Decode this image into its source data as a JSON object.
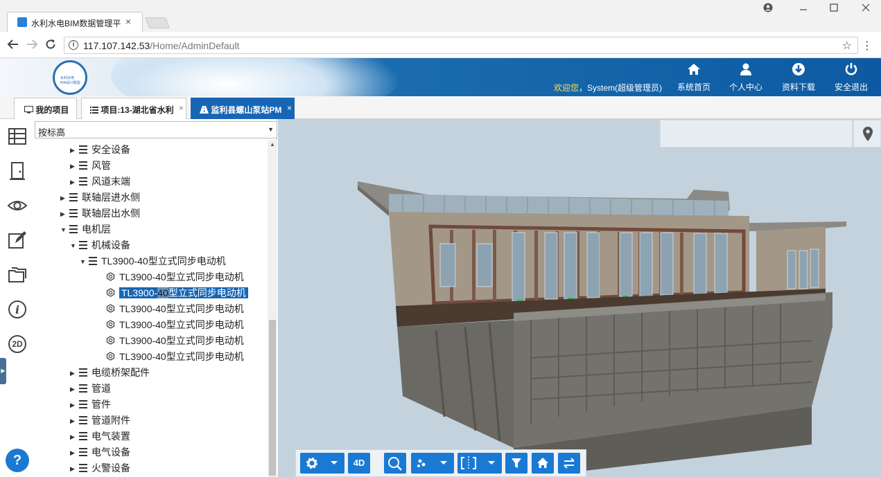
{
  "browser": {
    "tab_title": "水利水电BIM数据管理平",
    "tab_close": "×",
    "url_host": "117.107.142.53",
    "url_path": "/Home/AdminDefault"
  },
  "header": {
    "logo_line1": "水利水电",
    "logo_line2": "BIM设计联盟",
    "welcome_word": "欢迎您",
    "welcome_user": "，System(超级管理员)",
    "nav": [
      {
        "label": "系统首页",
        "icon": "home-icon"
      },
      {
        "label": "个人中心",
        "icon": "user-icon"
      },
      {
        "label": "资料下载",
        "icon": "download-icon"
      },
      {
        "label": "安全退出",
        "icon": "power-icon"
      }
    ]
  },
  "app_tabs": [
    {
      "label": "我的项目",
      "icon": "monitor-icon"
    },
    {
      "label": "项目:13-湖北省水利",
      "icon": "list-icon",
      "close": "×"
    },
    {
      "label": "监利县螺山泵站PM",
      "icon": "road-icon",
      "close": "×",
      "active": true
    }
  ],
  "tree_panel": {
    "filter_value": "按标高",
    "nodes": [
      {
        "label": "安全设备",
        "level": 3,
        "toggle": "▶",
        "icon": "folder"
      },
      {
        "label": "风管",
        "level": 3,
        "toggle": "▶",
        "icon": "folder"
      },
      {
        "label": "风道末端",
        "level": 3,
        "toggle": "▶",
        "icon": "folder"
      },
      {
        "label": "联轴层进水侧",
        "level": 2,
        "toggle": "▶",
        "icon": "folder"
      },
      {
        "label": "联轴层出水侧",
        "level": 2,
        "toggle": "▶",
        "icon": "folder"
      },
      {
        "label": "电机层",
        "level": 2,
        "toggle": "▼",
        "icon": "folder"
      },
      {
        "label": "机械设备",
        "level": 3,
        "toggle": "▼",
        "icon": "folder"
      },
      {
        "label": "TL3900-40型立式同步电动机",
        "level": 4,
        "toggle": "▼",
        "icon": "folder"
      },
      {
        "label": "TL3900-40型立式同步电动机",
        "level": 5,
        "toggle": "",
        "icon": "leaf"
      },
      {
        "label_a": "TL3900-",
        "label_b": "40",
        "label_c": "型立式同步电动机",
        "level": 5,
        "toggle": "",
        "icon": "leaf",
        "selected": true
      },
      {
        "label": "TL3900-40型立式同步电动机",
        "level": 5,
        "toggle": "",
        "icon": "leaf"
      },
      {
        "label": "TL3900-40型立式同步电动机",
        "level": 5,
        "toggle": "",
        "icon": "leaf"
      },
      {
        "label": "TL3900-40型立式同步电动机",
        "level": 5,
        "toggle": "",
        "icon": "leaf"
      },
      {
        "label": "TL3900-40型立式同步电动机",
        "level": 5,
        "toggle": "",
        "icon": "leaf"
      },
      {
        "label": "电缆桥架配件",
        "level": 3,
        "toggle": "▶",
        "icon": "folder"
      },
      {
        "label": "管道",
        "level": 3,
        "toggle": "▶",
        "icon": "folder"
      },
      {
        "label": "管件",
        "level": 3,
        "toggle": "▶",
        "icon": "folder"
      },
      {
        "label": "管道附件",
        "level": 3,
        "toggle": "▶",
        "icon": "folder"
      },
      {
        "label": "电气装置",
        "level": 3,
        "toggle": "▶",
        "icon": "folder"
      },
      {
        "label": "电气设备",
        "level": 3,
        "toggle": "▶",
        "icon": "folder"
      },
      {
        "label": "火警设备",
        "level": 3,
        "toggle": "▶",
        "icon": "folder"
      }
    ]
  },
  "sidebar": {
    "items": [
      "layers-icon",
      "door-icon",
      "eye-icon",
      "edit-icon",
      "folders-icon",
      "info-icon",
      "2d-icon"
    ],
    "label_2d": "2D",
    "help": "?"
  },
  "toolbar": {
    "label_4d": "4D",
    "buttons": [
      "settings-icon",
      "4d-button",
      "zoom-icon",
      "explode-icon",
      "section-icon",
      "filter-icon",
      "home-icon",
      "swap-icon"
    ]
  },
  "colors": {
    "accent": "#1766b5",
    "toolbar_blue": "#1a79d3",
    "viewport_bg": "#c3d2dd"
  }
}
